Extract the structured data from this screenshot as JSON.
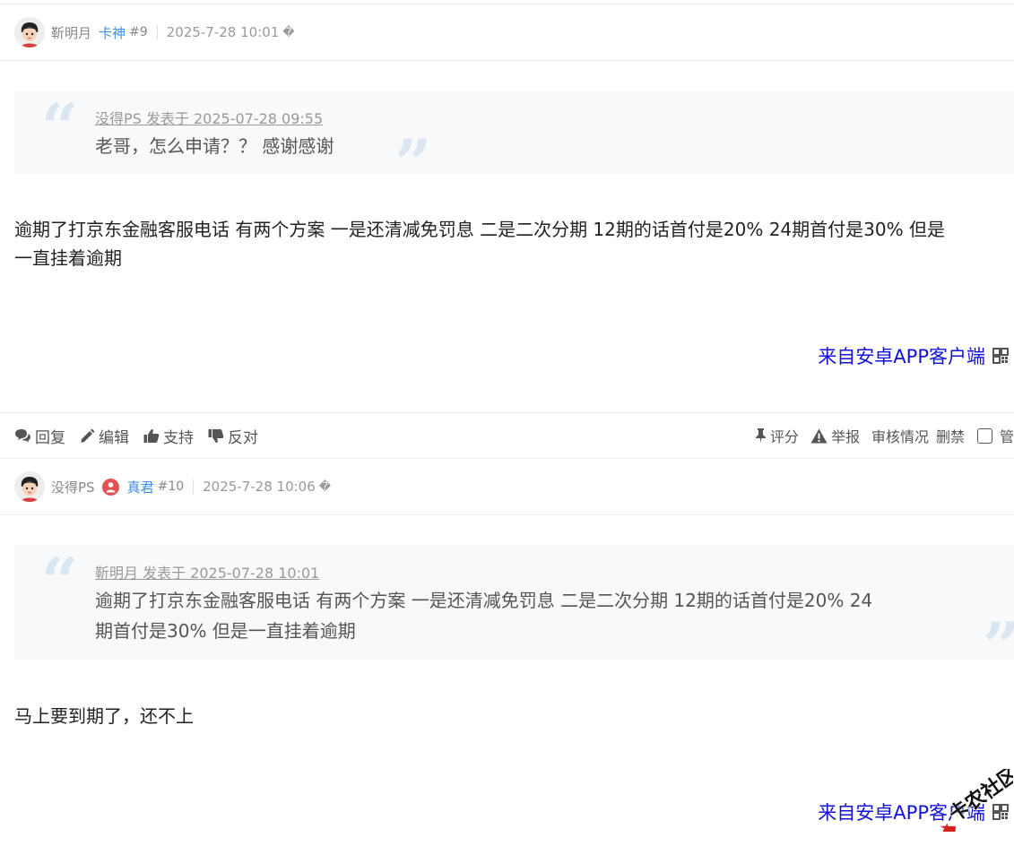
{
  "post9": {
    "author": "靳明月",
    "level": "卡神",
    "floor": "#9",
    "time": "2025-7-28 10:01",
    "glyph": "�",
    "quote_cite": "没得PS 发表于 2025-07-28 09:55",
    "quote_body": "老哥，怎么申请？？ 感谢感谢",
    "content_line1": "逾期了打京东金融客服电话 有两个方案 一是还清减免罚息 二是二次分期 12期的话首付是20% 24期首付是30% 但是",
    "content_line2": "一直挂着逾期",
    "source": "来自安卓APP客户端"
  },
  "actions": {
    "reply": "回复",
    "edit": "编辑",
    "support": "支持",
    "oppose": "反对",
    "rate": "评分",
    "report": "举报",
    "review": "审核情况",
    "ban": "删禁",
    "manage": "管"
  },
  "post10": {
    "author": "没得PS",
    "level": "真君",
    "floor": "#10",
    "time": "2025-7-28 10:06",
    "glyph": "�",
    "quote_cite": "靳明月 发表于 2025-07-28 10:01",
    "quote_body_line1": "逾期了打京东金融客服电话 有两个方案 一是还清减免罚息 二是二次分期 12期的话首付是20% 24",
    "quote_body_line2": "期首付是30% 但是一直挂着逾期",
    "content": "马上要到期了，还不上",
    "source": "来自安卓APP客户端"
  },
  "watermark": {
    "text": "卡农社区"
  },
  "colors": {
    "link_blue": "#1212d8",
    "level_blue": "#3d8ee6",
    "quote_bg": "#f8f9fa",
    "quote_mark": "#dbe6f1",
    "verify_red": "#e25252"
  }
}
